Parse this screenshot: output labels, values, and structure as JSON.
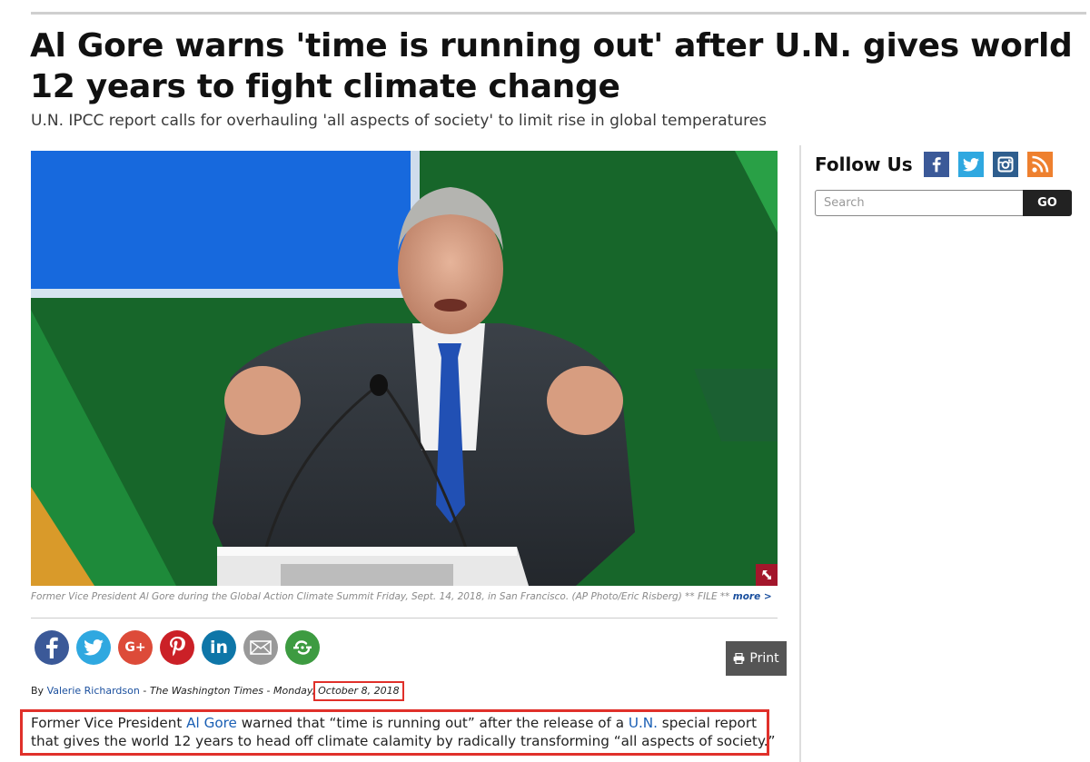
{
  "article": {
    "headline": "Al Gore warns 'time is running out' after U.N. gives world 12 years to fight climate change",
    "subheadline": "U.N. IPCC report calls for overhauling 'all aspects of society' to limit rise in global temperatures",
    "photo": {
      "alt": "Al Gore speaking at a podium in front of a green and blue backdrop",
      "expand_icon": "expand-arrow-icon",
      "caption": "Former Vice President Al Gore during the Global Action Climate Summit Friday, Sept. 14, 2018, in San Francisco. (AP Photo/Eric Risberg) ** FILE ** ",
      "more_link": "more >"
    },
    "share_buttons": [
      {
        "name": "facebook",
        "icon": "facebook-icon",
        "color": "#3b5998"
      },
      {
        "name": "twitter",
        "icon": "twitter-icon",
        "color": "#2fa8e0"
      },
      {
        "name": "google-plus",
        "icon": "google-plus-icon",
        "color": "#dd4b39",
        "glyph": "G+"
      },
      {
        "name": "pinterest",
        "icon": "pinterest-icon",
        "color": "#cb2027"
      },
      {
        "name": "linkedin",
        "icon": "linkedin-icon",
        "color": "#0e76a8",
        "glyph": "in"
      },
      {
        "name": "email",
        "icon": "email-icon",
        "color": "#999999"
      },
      {
        "name": "more",
        "icon": "share-more-icon",
        "color": "#3d9b41"
      }
    ],
    "print_label": "Print",
    "byline": {
      "prefix": "By ",
      "author": "Valerie Richardson",
      "separator": " - ",
      "publication": "The Washington Times",
      "day": "Monday,",
      "date": "October 8, 2018"
    },
    "body": {
      "p1_before": "Former Vice President ",
      "link1": "Al Gore",
      "p1_mid": " warned that “time is running out” after the release of a ",
      "link2": "U.N.",
      "p1_after": " special report that gives the world 12 years to head off climate calamity by radically transforming “all aspects of society.”"
    },
    "highlight_color": "#e0302a"
  },
  "sidebar": {
    "follow_label": "Follow Us",
    "social": [
      {
        "name": "facebook",
        "icon": "facebook-icon",
        "color": "#3b5998"
      },
      {
        "name": "twitter",
        "icon": "twitter-icon",
        "color": "#2fa8e0"
      },
      {
        "name": "instagram",
        "icon": "instagram-icon",
        "color": "#2e5e8e"
      },
      {
        "name": "rss",
        "icon": "rss-icon",
        "color": "#ee802f"
      }
    ],
    "search": {
      "placeholder": "Search",
      "value": "",
      "button": "GO"
    }
  }
}
